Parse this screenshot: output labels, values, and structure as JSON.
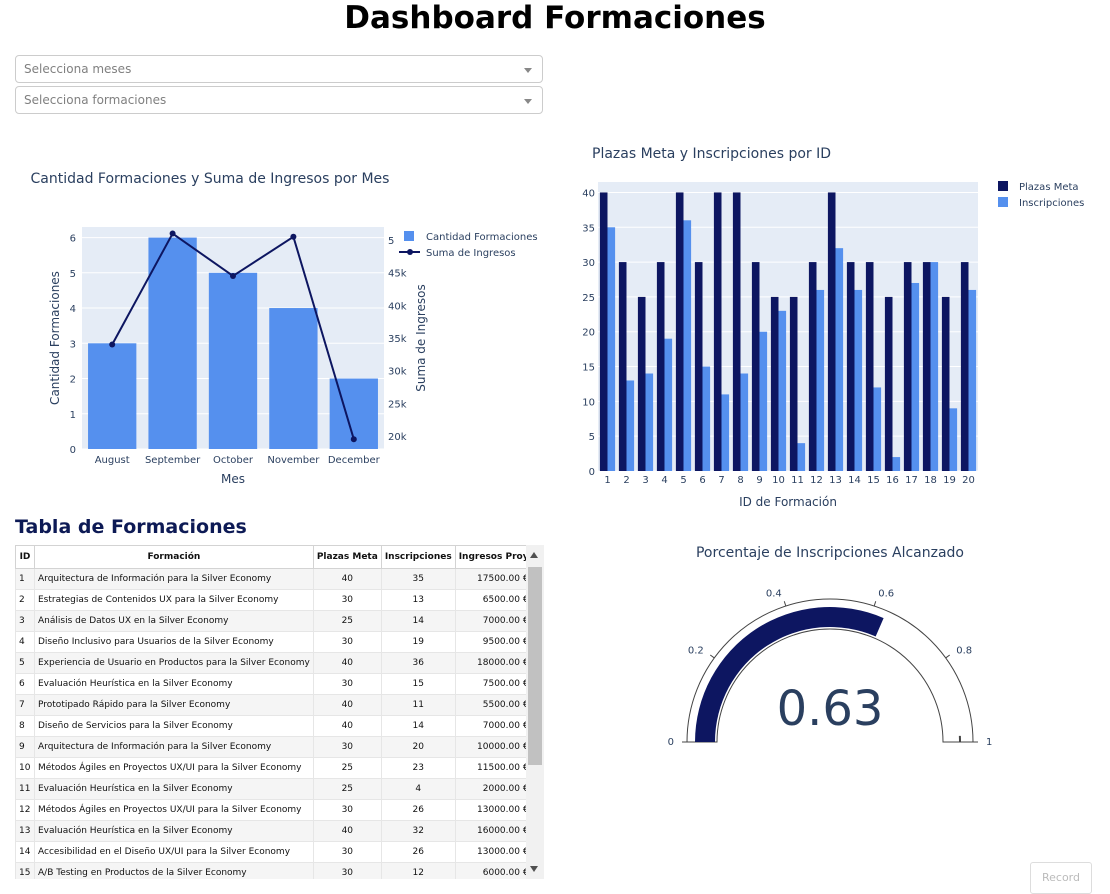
{
  "page": {
    "title": "Dashboard Formaciones"
  },
  "filters": {
    "months_placeholder": "Selecciona meses",
    "courses_placeholder": "Selecciona formaciones"
  },
  "colors": {
    "dark": "#0d1661",
    "light": "#5590ee",
    "plot_bg": "#e5ecf6"
  },
  "table": {
    "title": "Tabla de Formaciones",
    "columns": [
      "ID",
      "Formación",
      "Plazas Meta",
      "Inscripciones",
      "Ingresos Proy"
    ],
    "rows": [
      [
        "1",
        "Arquitectura de Información para la Silver Economy",
        "40",
        "35",
        "17500.00 €"
      ],
      [
        "2",
        "Estrategias de Contenidos UX para la Silver Economy",
        "30",
        "13",
        "6500.00 €"
      ],
      [
        "3",
        "Análisis de Datos UX en la Silver Economy",
        "25",
        "14",
        "7000.00 €"
      ],
      [
        "4",
        "Diseño Inclusivo para Usuarios de la Silver Economy",
        "30",
        "19",
        "9500.00 €"
      ],
      [
        "5",
        "Experiencia de Usuario en Productos para la Silver Economy",
        "40",
        "36",
        "18000.00 €"
      ],
      [
        "6",
        "Evaluación Heurística en la Silver Economy",
        "30",
        "15",
        "7500.00 €"
      ],
      [
        "7",
        "Prototipado Rápido para la Silver Economy",
        "40",
        "11",
        "5500.00 €"
      ],
      [
        "8",
        "Diseño de Servicios para la Silver Economy",
        "40",
        "14",
        "7000.00 €"
      ],
      [
        "9",
        "Arquitectura de Información para la Silver Economy",
        "30",
        "20",
        "10000.00 €"
      ],
      [
        "10",
        "Métodos Ágiles en Proyectos UX/UI para la Silver Economy",
        "25",
        "23",
        "11500.00 €"
      ],
      [
        "11",
        "Evaluación Heurística en la Silver Economy",
        "25",
        "4",
        "2000.00 €"
      ],
      [
        "12",
        "Métodos Ágiles en Proyectos UX/UI para la Silver Economy",
        "30",
        "26",
        "13000.00 €"
      ],
      [
        "13",
        "Evaluación Heurística en la Silver Economy",
        "40",
        "32",
        "16000.00 €"
      ],
      [
        "14",
        "Accesibilidad en el Diseño UX/UI para la Silver Economy",
        "30",
        "26",
        "13000.00 €"
      ],
      [
        "15",
        "A/B Testing en Productos de la Silver Economy",
        "30",
        "12",
        "6000.00 €"
      ]
    ]
  },
  "corner_button": {
    "label": "Record"
  },
  "chart_data": [
    {
      "type": "bar",
      "title": "Cantidad Formaciones y Suma de Ingresos por Mes",
      "xlabel": "Mes",
      "ylabel": "Cantidad Formaciones",
      "y2label": "Suma de Ingresos",
      "categories": [
        "August",
        "September",
        "October",
        "November",
        "December"
      ],
      "ylim": [
        0,
        6.3
      ],
      "y2lim": [
        18000,
        52000
      ],
      "yticks": [
        0,
        1,
        2,
        3,
        4,
        5,
        6
      ],
      "y2ticks": [
        20000,
        25000,
        30000,
        35000,
        40000,
        45000,
        50000
      ],
      "y2ticklabels": [
        "20k",
        "25k",
        "30k",
        "35k",
        "40k",
        "45k",
        "5"
      ],
      "legend_position": "top-right",
      "series": [
        {
          "name": "Cantidad Formaciones",
          "type": "bar",
          "values": [
            3,
            6,
            5,
            4,
            2
          ]
        },
        {
          "name": "Suma de Ingresos",
          "type": "line",
          "axis": "y2",
          "values": [
            34000,
            51000,
            44500,
            50500,
            19500
          ]
        }
      ]
    },
    {
      "type": "bar",
      "title": "Plazas Meta y Inscripciones por ID",
      "xlabel": "ID de Formación",
      "ylabel": "",
      "categories": [
        "1",
        "2",
        "3",
        "4",
        "5",
        "6",
        "7",
        "8",
        "9",
        "10",
        "11",
        "12",
        "13",
        "14",
        "15",
        "16",
        "17",
        "18",
        "19",
        "20"
      ],
      "ylim": [
        0,
        41.5
      ],
      "yticks": [
        0,
        5,
        10,
        15,
        20,
        25,
        30,
        35,
        40
      ],
      "legend_position": "top-right",
      "series": [
        {
          "name": "Plazas Meta",
          "values": [
            40,
            30,
            25,
            30,
            40,
            30,
            40,
            40,
            30,
            25,
            25,
            30,
            40,
            30,
            30,
            25,
            30,
            30,
            25,
            30
          ]
        },
        {
          "name": "Inscripciones",
          "values": [
            35,
            13,
            14,
            19,
            36,
            15,
            11,
            14,
            20,
            23,
            4,
            26,
            32,
            26,
            12,
            2,
            27,
            30,
            9,
            26
          ]
        }
      ]
    },
    {
      "type": "gauge",
      "title": "Porcentaje de Inscripciones Alcanzado",
      "value": 0.63,
      "value_label": "0.63",
      "range": [
        0,
        1
      ],
      "ticks": [
        "0",
        "0.2",
        "0.4",
        "0.6",
        "0.8",
        "1"
      ]
    }
  ]
}
